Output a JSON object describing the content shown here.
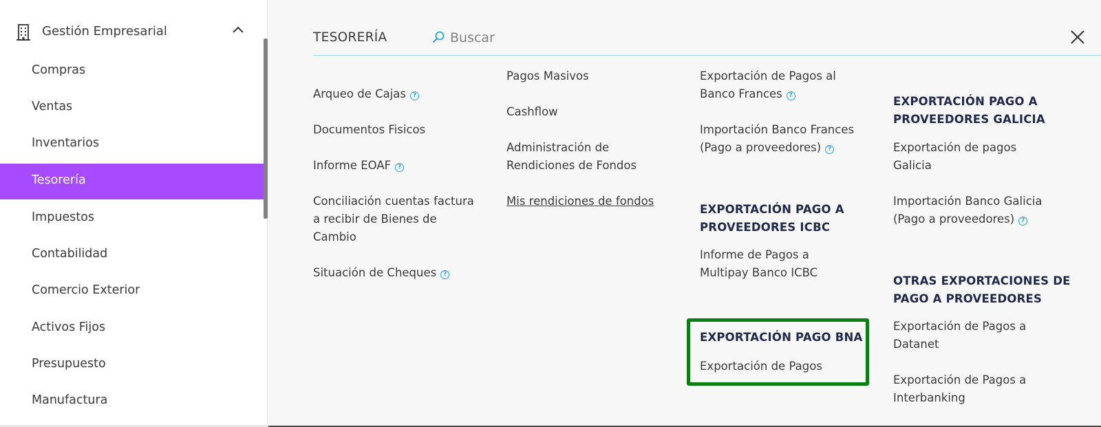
{
  "sidebar": {
    "header_title": "Gestión Empresarial",
    "items": [
      {
        "label": "Compras"
      },
      {
        "label": "Ventas"
      },
      {
        "label": "Inventarios"
      },
      {
        "label": "Tesorería",
        "active": true
      },
      {
        "label": "Impuestos"
      },
      {
        "label": "Contabilidad"
      },
      {
        "label": "Comercio Exterior"
      },
      {
        "label": "Activos Fijos"
      },
      {
        "label": "Presupuesto"
      },
      {
        "label": "Manufactura"
      }
    ]
  },
  "panel": {
    "title": "TESORERÍA",
    "search_placeholder": "Buscar",
    "col1": [
      "Arqueo de Cajas",
      "Documentos Fisicos",
      "Informe EOAF",
      "Conciliación cuentas factura",
      "a recibir de Bienes de",
      "Cambio",
      "Situación de Cheques"
    ],
    "col2": [
      "Pagos Masivos",
      "Cashflow",
      "Administración de",
      "Rendiciones de Fondos",
      "Mis rendiciones de fondos"
    ],
    "col3": {
      "items": [
        "Exportación de Pagos al",
        "Banco Frances",
        "Importación Banco Frances",
        "(Pago a proveedores)"
      ],
      "icbc_title_1": "EXPORTACIÓN PAGO A",
      "icbc_title_2": "PROVEEDORES ICBC",
      "icbc_items": [
        "Informe de Pagos a",
        "Multipay Banco ICBC"
      ],
      "bna_title": "EXPORTACIÓN PAGO BNA",
      "bna_items": [
        "Exportación de Pagos"
      ]
    },
    "col4": {
      "galicia_title_1": "EXPORTACIÓN PAGO A",
      "galicia_title_2": "PROVEEDORES GALICIA",
      "galicia_items": [
        "Exportación de pagos",
        "Galicia",
        "Importación Banco Galicia",
        "(Pago a proveedores)"
      ],
      "otras_title_1": "OTRAS EXPORTACIONES DE",
      "otras_title_2": "PAGO A PROVEEDORES",
      "otras_items": [
        "Exportación de Pagos a",
        "Datanet",
        "Exportación de Pagos a",
        "Interbanking"
      ]
    },
    "help_glyph": "?"
  },
  "colors": {
    "active": "#a64bff",
    "highlight": "#0a7e12",
    "help": "#22a7d9",
    "group_title": "#1f2a4a"
  }
}
